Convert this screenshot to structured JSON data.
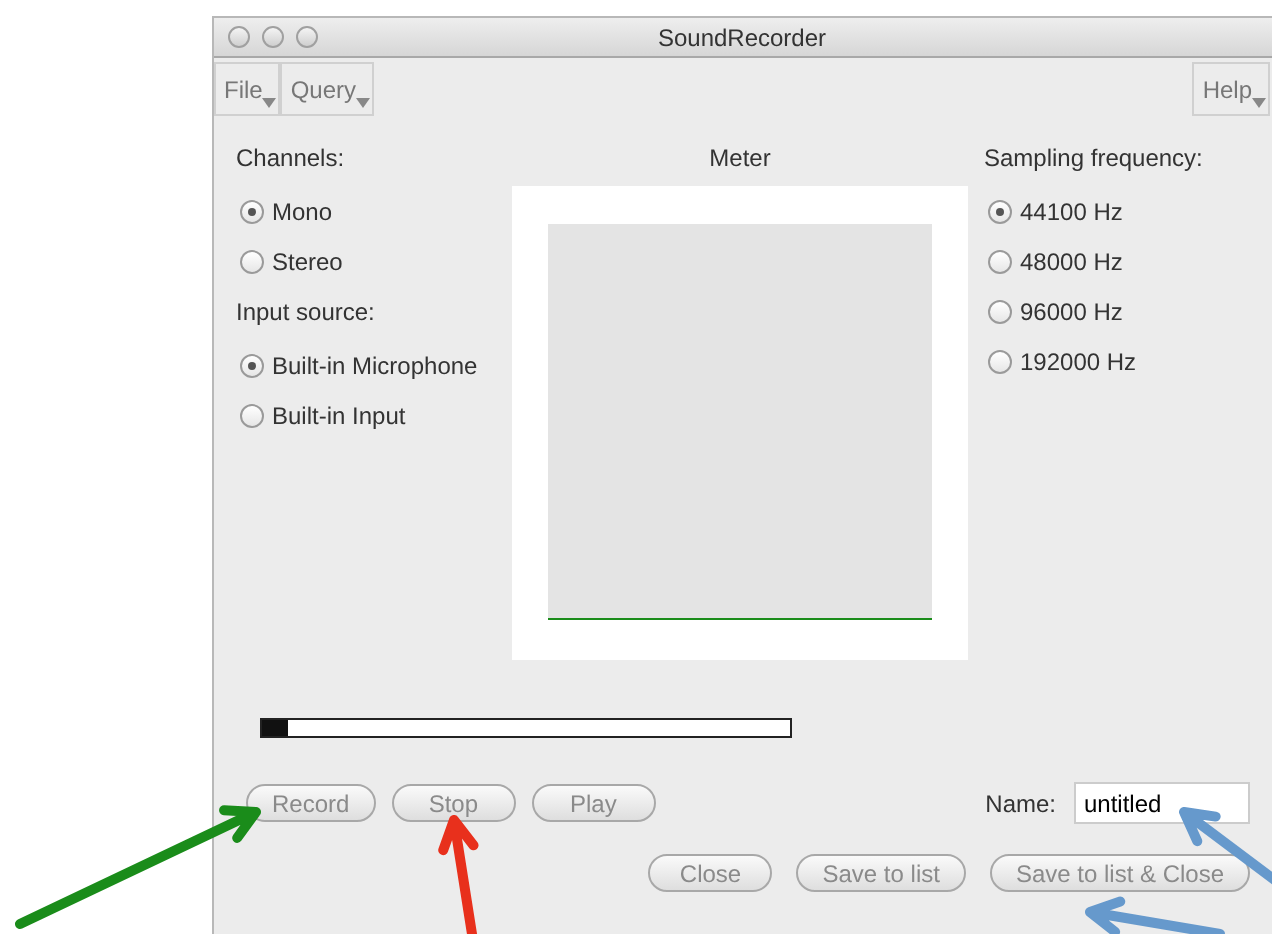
{
  "window": {
    "title": "SoundRecorder"
  },
  "menus": [
    {
      "label": "File"
    },
    {
      "label": "Query"
    }
  ],
  "help_menu": {
    "label": "Help"
  },
  "channels": {
    "label": "Channels:",
    "options": [
      {
        "label": "Mono",
        "selected": true
      },
      {
        "label": "Stereo",
        "selected": false
      }
    ]
  },
  "input_source": {
    "label": "Input source:",
    "options": [
      {
        "label": "Built-in Microphone",
        "selected": true
      },
      {
        "label": "Built-in Input",
        "selected": false
      }
    ]
  },
  "meter": {
    "label": "Meter"
  },
  "sampling_frequency": {
    "label": "Sampling frequency:",
    "options": [
      {
        "label": "44100 Hz",
        "selected": true
      },
      {
        "label": "48000 Hz",
        "selected": false
      },
      {
        "label": "96000 Hz",
        "selected": false
      },
      {
        "label": "192000 Hz",
        "selected": false
      }
    ]
  },
  "progress": {
    "level": 0.05
  },
  "transport_buttons": [
    {
      "label": "Record"
    },
    {
      "label": "Stop"
    },
    {
      "label": "Play"
    }
  ],
  "name_field": {
    "label": "Name:",
    "value": "untitled"
  },
  "dialog_buttons": [
    {
      "label": "Close"
    },
    {
      "label": "Save to list"
    },
    {
      "label": "Save to list & Close"
    }
  ],
  "annotation_arrows": [
    {
      "color": "#1a8c1a"
    },
    {
      "color": "#e8301c"
    },
    {
      "color": "#6699cc"
    },
    {
      "color": "#6699cc"
    }
  ]
}
